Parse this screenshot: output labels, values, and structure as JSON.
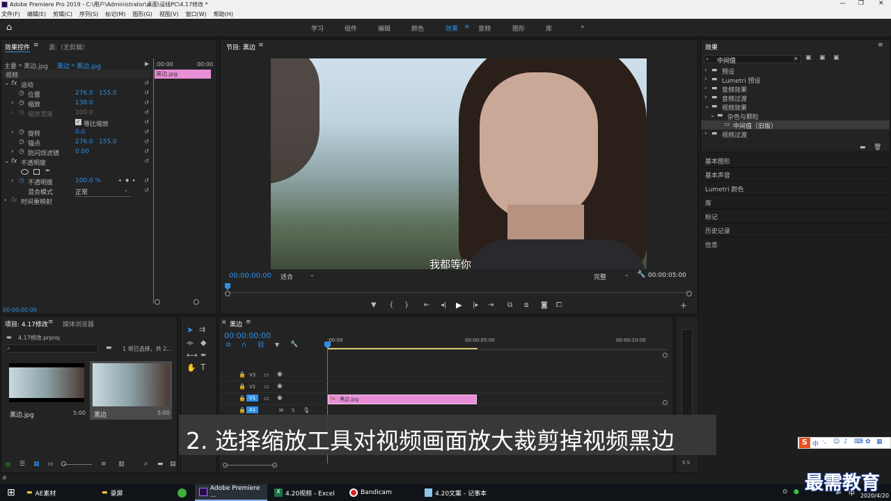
{
  "titlebar": {
    "title": "Adobe Premiere Pro 2019 - C:\\用户\\Administrator\\桌面\\设线PC\\4.17修改 *"
  },
  "menus": [
    "文件(F)",
    "编辑(E)",
    "剪辑(C)",
    "序列(S)",
    "标记(M)",
    "图形(G)",
    "视图(V)",
    "窗口(W)",
    "帮助(H)"
  ],
  "workspaces": [
    "学习",
    "组件",
    "编辑",
    "颜色",
    "效果",
    "音频",
    "图形",
    "库"
  ],
  "active_workspace": "效果",
  "effect_controls": {
    "tab_label": "效果控件",
    "source_label": "源:（无剪辑）",
    "master": "主要 * 黑边.jpg",
    "clip": "黑边 * 黑边.jpg",
    "ruler_start": ":00:00",
    "ruler_end": "00:00",
    "clip_bar": "黑边.jpg",
    "section_video": "视频",
    "motion": "运动",
    "position_label": "位置",
    "position_x": "276.0",
    "position_y": "155.0",
    "scale_label": "缩放",
    "scale_value": "138.0",
    "scale_width_label": "缩放宽度",
    "scale_width_value": "100.0",
    "uniform_label": "等比缩放",
    "rotation_label": "旋转",
    "rotation_value": "0.0",
    "anchor_label": "锚点",
    "anchor_x": "276.0",
    "anchor_y": "155.0",
    "flicker_label": "防闪烁滤镜",
    "flicker_value": "0.00",
    "opacity_section": "不透明度",
    "opacity_label": "不透明度",
    "opacity_value": "100.0 %",
    "blend_label": "混合模式",
    "blend_value": "正常",
    "time_remap": "时间重映射",
    "timecode": "00:00:00:00"
  },
  "program": {
    "tab_label": "节目: 黑边",
    "subtitle": "我都等你",
    "timecode": "00:00:00:00",
    "fit": "适合",
    "quality": "完整",
    "duration": "00:00:05:00"
  },
  "effects_panel": {
    "title": "效果",
    "search_value": "中间值",
    "tree": [
      "预设",
      "Lumetri 预设",
      "音频效果",
      "音频过渡",
      "视频效果",
      "杂色与颗粒",
      "中间值（旧版）",
      "视频过渡"
    ],
    "sections": [
      "基本图形",
      "基本声音",
      "Lumetri 颜色",
      "库",
      "标记",
      "历史记录",
      "信息"
    ]
  },
  "project": {
    "tab_label": "项目: 4.17修改",
    "tab_media": "媒体浏览器",
    "file": "4.17修改.prproj",
    "selection": "1 项已选择，共 2...",
    "items": [
      {
        "name": "黑边.jpg",
        "duration": "5:00"
      },
      {
        "name": "黑边",
        "duration": "5:00"
      }
    ]
  },
  "timeline": {
    "tab_label": "黑边",
    "timecode": "00:00:00:00",
    "ruler": [
      ":00:00",
      "00:00:05:00",
      "00:00:10:00"
    ],
    "tracks": [
      "V3",
      "V2",
      "V1",
      "A1"
    ],
    "clip_label": "黑边.jpg"
  },
  "audio_meter": {
    "label": "S S"
  },
  "caption": "2. 选择缩放工具对视频画面放大裁剪掉视频黑边",
  "watermark": "最需教育",
  "taskbar": {
    "items": [
      "AE素材",
      "录屏",
      "",
      "Adobe Premiere ...",
      "4.20视频 - Excel",
      "Bandicam",
      "4.20文案 - 记事本"
    ],
    "ime": "中",
    "date": "2020/4/20"
  },
  "colors": {
    "accent": "#2e8fe8",
    "clip_pink": "#e88fd8",
    "caption_bg": "#3a3a3a"
  }
}
